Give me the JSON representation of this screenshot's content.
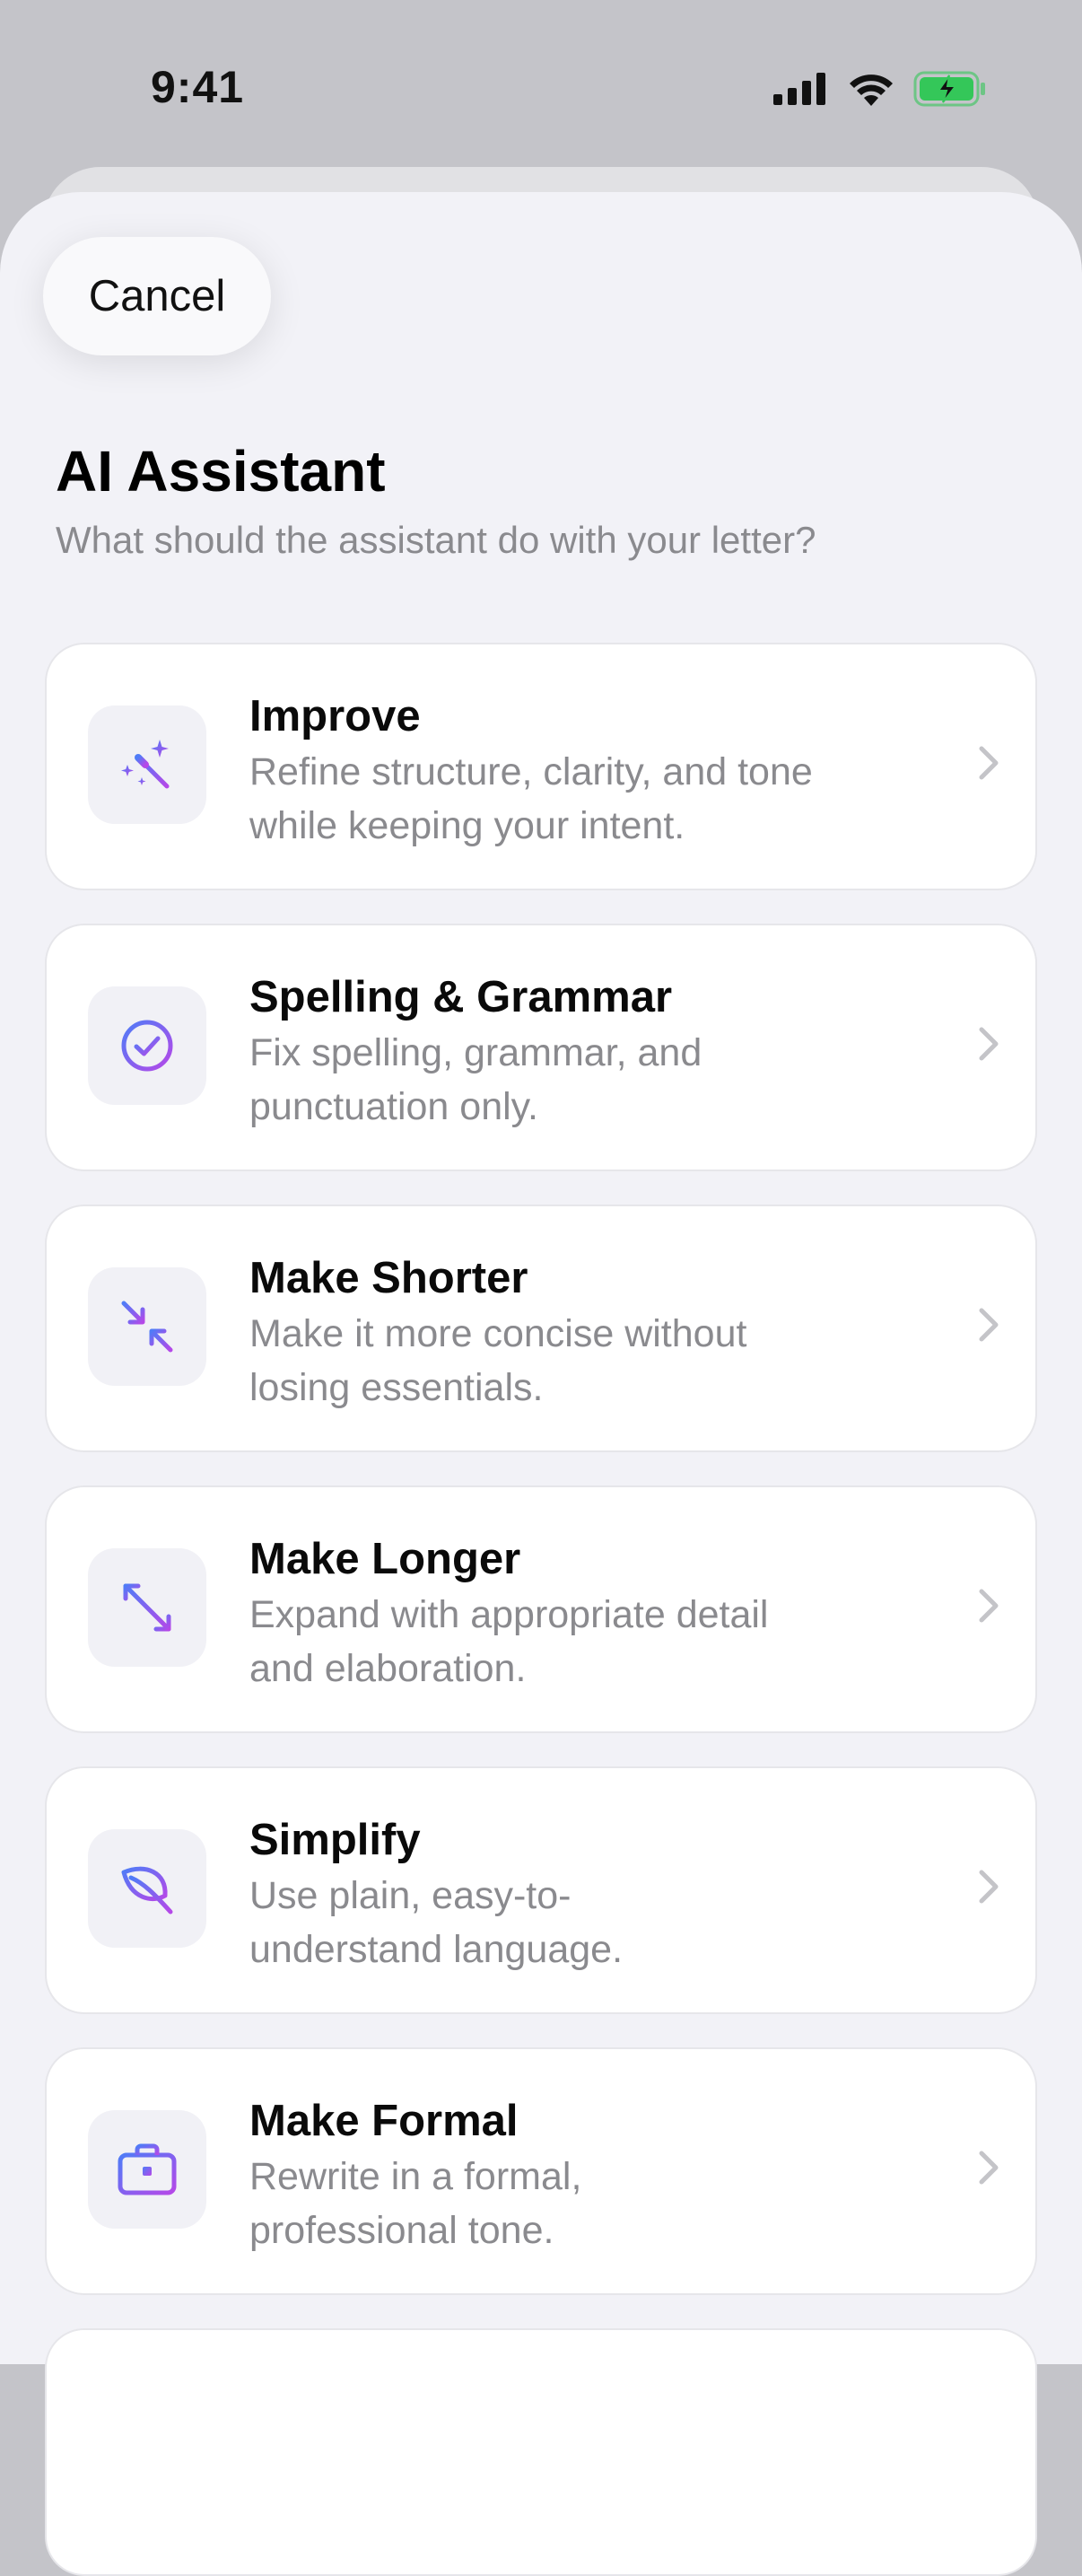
{
  "status_bar": {
    "time": "9:41"
  },
  "header": {
    "cancel_label": "Cancel",
    "title": "AI Assistant",
    "subtitle": "What should the assistant do with your letter?"
  },
  "actions": [
    {
      "label": "Improve",
      "desc_line1": "Refine structure, clarity, and tone",
      "desc_line2": "while keeping your intent.",
      "icon": "magic-wand-icon"
    },
    {
      "label": "Spelling & Grammar",
      "desc_line1": "Fix spelling, grammar, and",
      "desc_line2": "punctuation only.",
      "icon": "checkmark-circle-icon"
    },
    {
      "label": "Make Shorter",
      "desc_line1": "Make it more concise without",
      "desc_line2": "losing essentials.",
      "icon": "arrows-inward-icon"
    },
    {
      "label": "Make Longer",
      "desc_line1": "Expand with appropriate detail",
      "desc_line2": "and elaboration.",
      "icon": "arrows-outward-icon"
    },
    {
      "label": "Simplify",
      "desc_line1": "Use plain, easy-to-",
      "desc_line2": "understand language.",
      "icon": "leaf-icon"
    },
    {
      "label": "Make Formal",
      "desc_line1": "Rewrite in a formal,",
      "desc_line2": "professional tone.",
      "icon": "briefcase-icon"
    }
  ],
  "colors": {
    "accent_start": "#4f7cf7",
    "accent_end": "#b548e8",
    "battery": "#34c759"
  }
}
